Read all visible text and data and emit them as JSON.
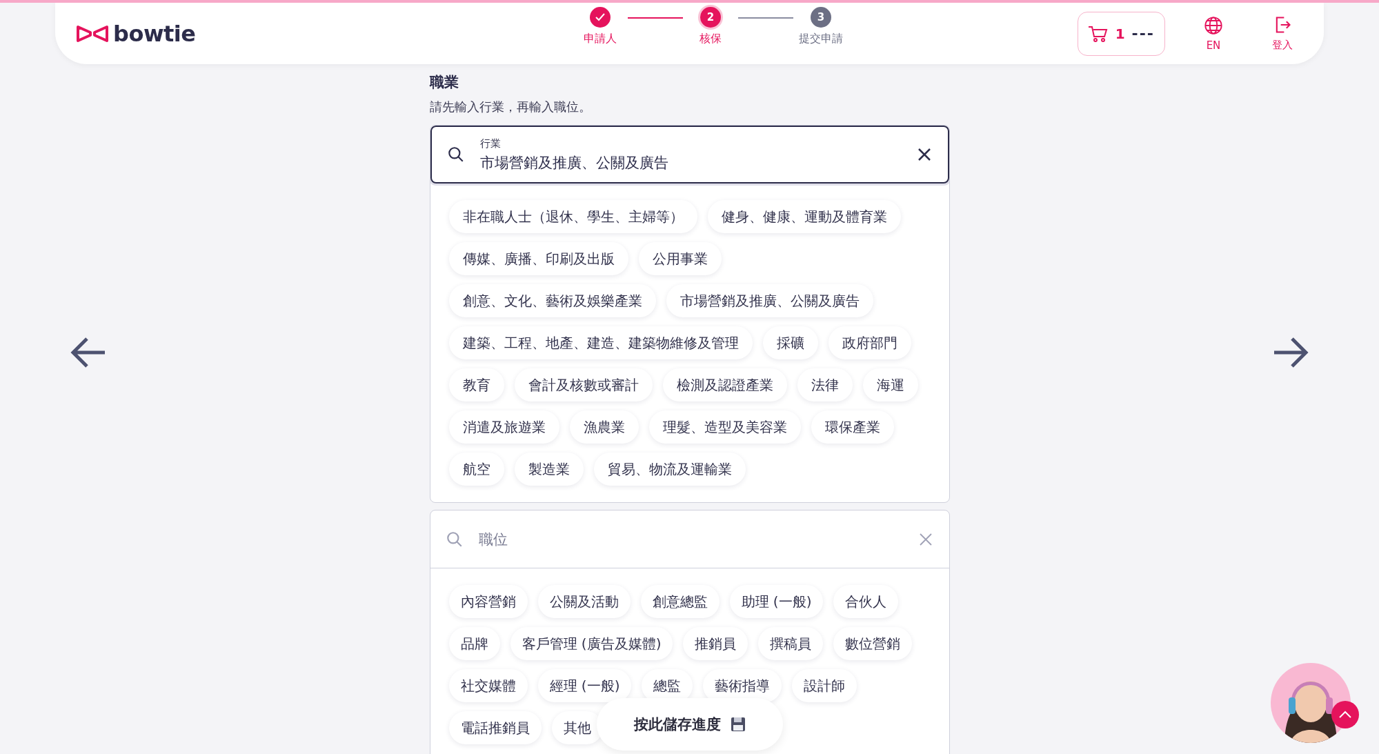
{
  "header": {
    "logo": "bowtie",
    "steps": [
      {
        "label": "申請人",
        "completed": true,
        "selected": false
      },
      {
        "number": "2",
        "label": "核保",
        "completed": false,
        "selected": true
      },
      {
        "number": "3",
        "label": "提交申請",
        "completed": false,
        "selected": false
      }
    ],
    "cart": {
      "count": "1",
      "amount": "---"
    },
    "language": "EN",
    "login": "登入"
  },
  "occupation": {
    "title": "職業",
    "hint": "請先輸入行業，再輸入職位。",
    "industry_field": {
      "label": "行業",
      "value": "市場營銷及推廣、公關及廣告",
      "focused": true
    },
    "industries": [
      "非在職人士（退休、學生、主婦等）",
      "健身、健康、運動及體育業",
      "傳媒、廣播、印刷及出版",
      "公用事業",
      "創意、文化、藝術及娛樂產業",
      "市場營銷及推廣、公關及廣告",
      "建築、工程、地產、建造、建築物維修及管理",
      "採礦",
      "政府部門",
      "教育",
      "會計及核數或審計",
      "檢測及認證產業",
      "法律",
      "海運",
      "消遣及旅遊業",
      "漁農業",
      "理髮、造型及美容業",
      "環保產業",
      "航空",
      "製造業",
      "貿易、物流及運輸業"
    ],
    "position_field": {
      "placeholder": "職位",
      "focused": false
    },
    "positions": [
      "內容營銷",
      "公關及活動",
      "創意總監",
      "助理 (一般)",
      "合伙人",
      "品牌",
      "客戶管理 (廣告及媒體)",
      "推銷員",
      "撰稿員",
      "數位營銷",
      "社交媒體",
      "經理 (一般)",
      "總監",
      "藝術指導",
      "設計師",
      "電話推銷員",
      "其他"
    ]
  },
  "save_button": {
    "label": "按此儲存進度"
  }
}
